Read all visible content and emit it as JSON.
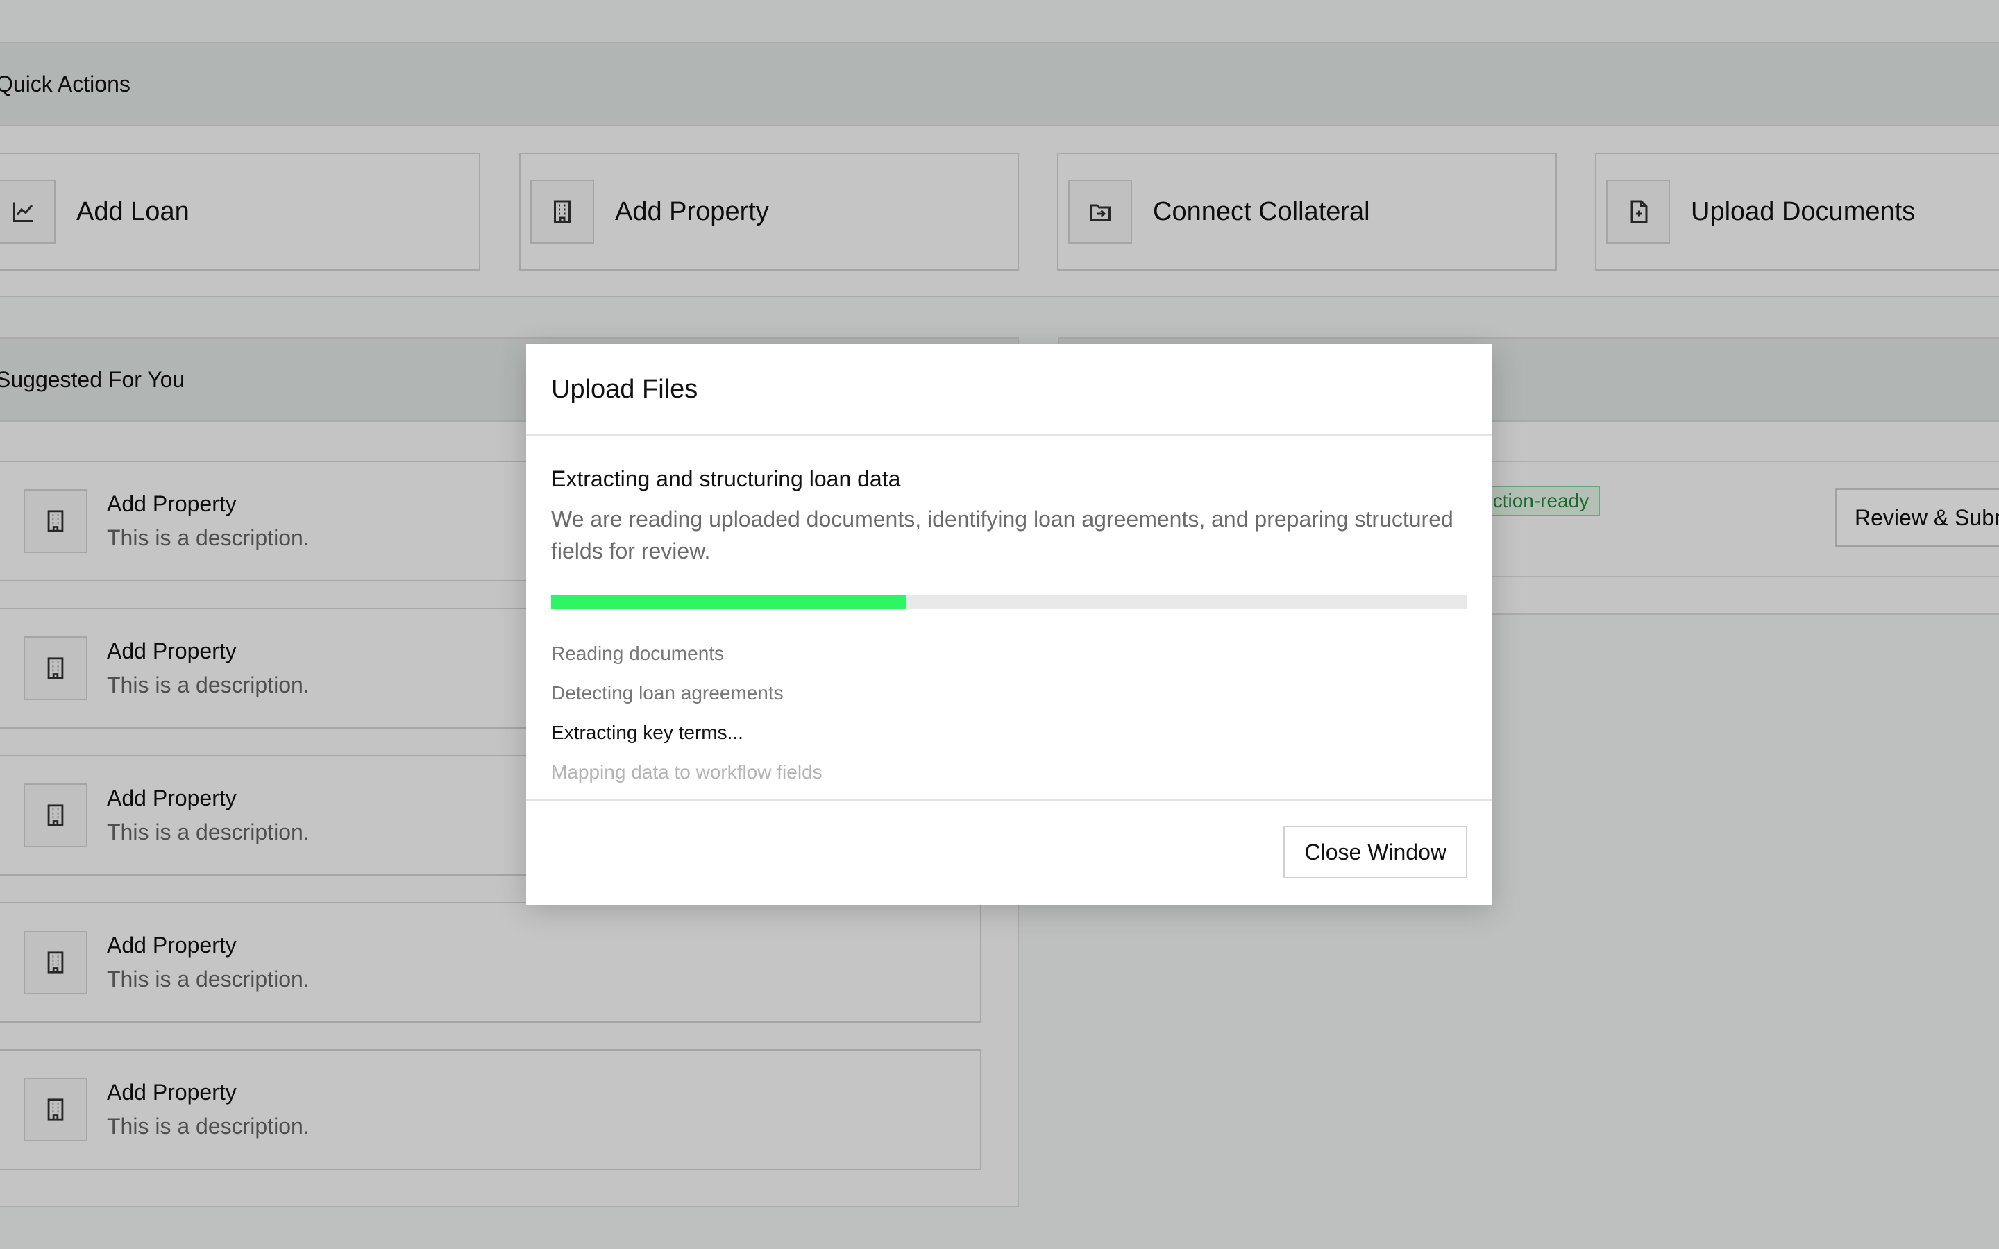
{
  "quick_actions": {
    "title": "Quick Actions",
    "items": [
      {
        "label": "Add Loan",
        "icon": "chart-line-icon"
      },
      {
        "label": "Add Property",
        "icon": "building-icon"
      },
      {
        "label": "Connect Collateral",
        "icon": "folder-link-icon"
      },
      {
        "label": "Upload Documents",
        "icon": "file-plus-icon"
      }
    ]
  },
  "suggested": {
    "title": "Suggested For You",
    "items": [
      {
        "title": "Add Property",
        "description": "This is a description."
      },
      {
        "title": "Add Property",
        "description": "This is a description."
      },
      {
        "title": "Add Property",
        "description": "This is a description."
      },
      {
        "title": "Add Property",
        "description": "This is a description."
      },
      {
        "title": "Add Property",
        "description": "This is a description."
      }
    ]
  },
  "right_panel": {
    "badge": "Production-ready",
    "review_button": "Review & Submit"
  },
  "modal": {
    "title": "Upload Files",
    "status_title": "Extracting and structuring loan data",
    "status_description": "We are reading uploaded documents, identifying loan agreements, and preparing structured fields for review.",
    "progress": 0.387,
    "steps": [
      {
        "label": "Reading documents",
        "state": "done"
      },
      {
        "label": "Detecting loan agreements",
        "state": "done"
      },
      {
        "label": "Extracting key terms...",
        "state": "active"
      },
      {
        "label": "Mapping data to workflow fields",
        "state": "pending"
      }
    ],
    "close_button": "Close Window"
  },
  "colors": {
    "progress_fill": "#2ef562",
    "badge_text": "#1f8a3a"
  }
}
